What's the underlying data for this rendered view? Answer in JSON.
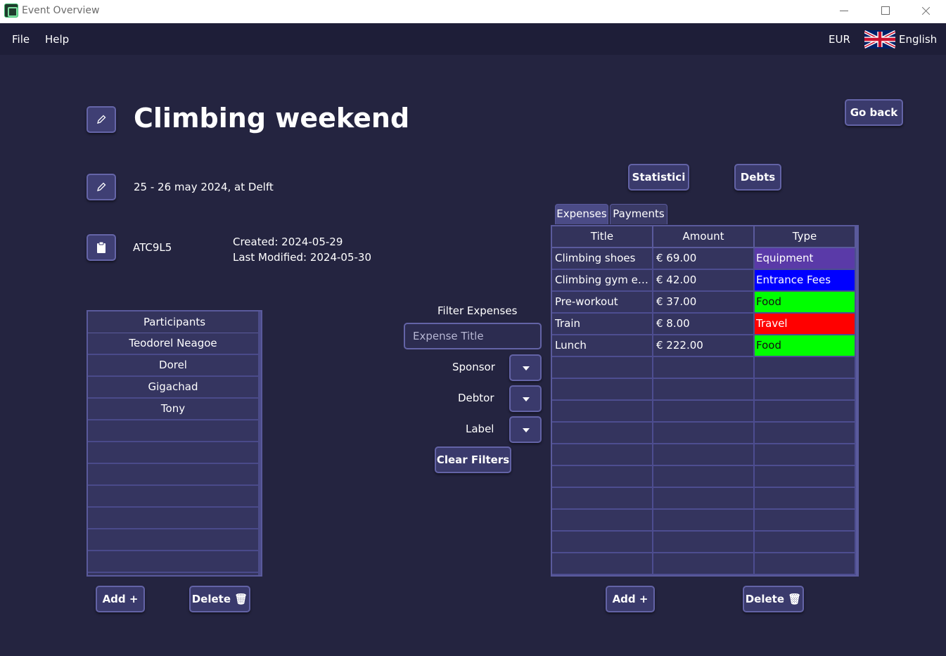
{
  "window": {
    "title": "Event Overview"
  },
  "menubar": {
    "file": "File",
    "help": "Help",
    "currency": "EUR",
    "language": "English",
    "flag_icon": "uk-flag-icon"
  },
  "event": {
    "title": "Climbing weekend",
    "date_location": "25 - 26 may 2024, at Delft",
    "invite_code": "ATC9L5",
    "created": "Created: 2024-05-29",
    "last_modified": "Last Modified: 2024-05-30",
    "edit_title_icon": "pencil-icon",
    "edit_details_icon": "pencil-icon",
    "copy_code_icon": "clipboard-icon"
  },
  "buttons": {
    "go_back": "Go back",
    "statistics": "Statistici",
    "debts": "Debts",
    "participants_add": "Add +",
    "participants_delete": "Delete 🗑",
    "expenses_add": "Add +",
    "expenses_delete": "Delete 🗑",
    "clear_filters": "Clear Filters"
  },
  "participants": {
    "header": "Participants",
    "items": [
      "Teodorel Neagoe",
      "Dorel",
      "Gigachad",
      "Tony",
      "",
      "",
      "",
      "",
      "",
      "",
      ""
    ]
  },
  "filters": {
    "heading": "Filter Expenses",
    "title_placeholder": "Expense Title",
    "sponsor_label": "Sponsor",
    "debtor_label": "Debtor",
    "label_label": "Label"
  },
  "tabs": {
    "expenses": "Expenses",
    "payments": "Payments"
  },
  "expenses_table": {
    "columns": [
      "Title",
      "Amount",
      "Type"
    ],
    "rows": [
      {
        "title": "Climbing shoes",
        "amount": "€ 69.00",
        "type": "Equipment",
        "type_color": "#5a3aa8"
      },
      {
        "title": "Climbing gym ent...",
        "amount": "€ 42.00",
        "type": "Entrance Fees",
        "type_color": "#0000ff"
      },
      {
        "title": "Pre-workout",
        "amount": "€ 37.00",
        "type": "Food",
        "type_color": "#00ff00"
      },
      {
        "title": "Train",
        "amount": "€ 8.00",
        "type": "Travel",
        "type_color": "#ff0000"
      },
      {
        "title": "Lunch",
        "amount": "€ 222.00",
        "type": "Food",
        "type_color": "#00ff00"
      }
    ],
    "empty_rows": 10
  },
  "colors": {
    "background": "#242440",
    "panel": "#34345e",
    "border_accent": "#6363a6"
  }
}
